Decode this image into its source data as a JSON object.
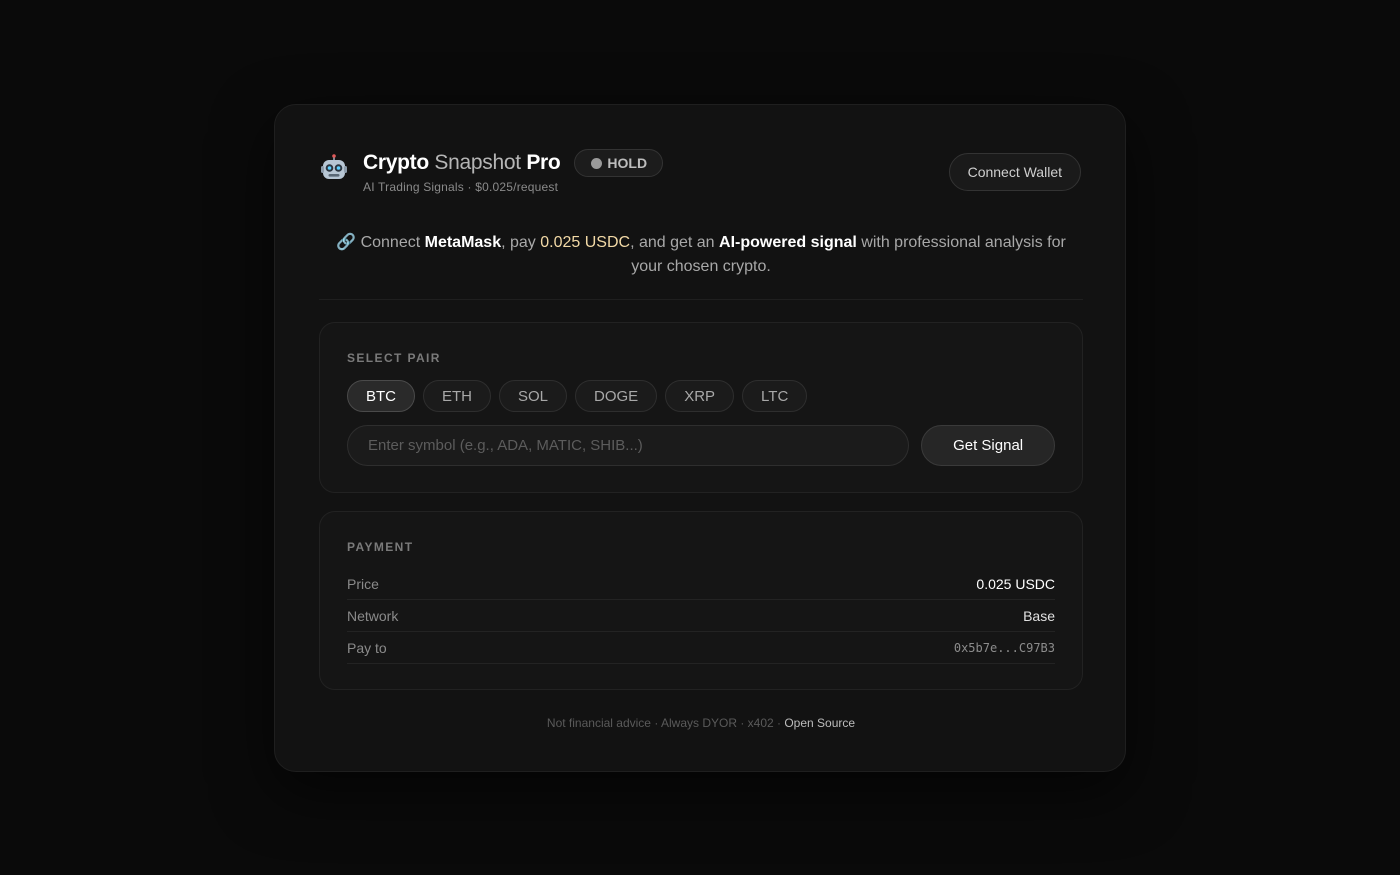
{
  "header": {
    "logo_icon": "robot-icon",
    "title_part1": "Crypto",
    "title_part2": "Snapshot",
    "title_part3": "Pro",
    "badge": "HOLD",
    "subtitle": "AI Trading Signals · $0.025/request",
    "connect_label": "Connect Wallet"
  },
  "intro": {
    "link_icon": "link-icon",
    "t1": "Connect ",
    "b1": "MetaMask",
    "t2": ", pay ",
    "hl": "0.025 USDC",
    "t3": ", and get an ",
    "b2": "AI-powered signal",
    "t4": " with professional analysis for your chosen crypto."
  },
  "pair": {
    "label": "SELECT PAIR",
    "pills": [
      "BTC",
      "ETH",
      "SOL",
      "DOGE",
      "XRP",
      "LTC"
    ],
    "active": "BTC",
    "input_placeholder": "Enter symbol (e.g., ADA, MATIC, SHIB...)",
    "input_value": "",
    "button_label": "Get Signal"
  },
  "payment": {
    "label": "PAYMENT",
    "rows": [
      {
        "key": "Price",
        "value": "0.025 USDC"
      },
      {
        "key": "Network",
        "value": "Base"
      },
      {
        "key": "Pay to",
        "value": "0x5b7e...C97B3"
      }
    ]
  },
  "footer": {
    "text": "Not financial advice · Always DYOR · x402 · ",
    "link": "Open Source"
  },
  "colors": {
    "background": "#0a0a0a",
    "card": "#121212",
    "highlight": "#f2d9a6"
  }
}
